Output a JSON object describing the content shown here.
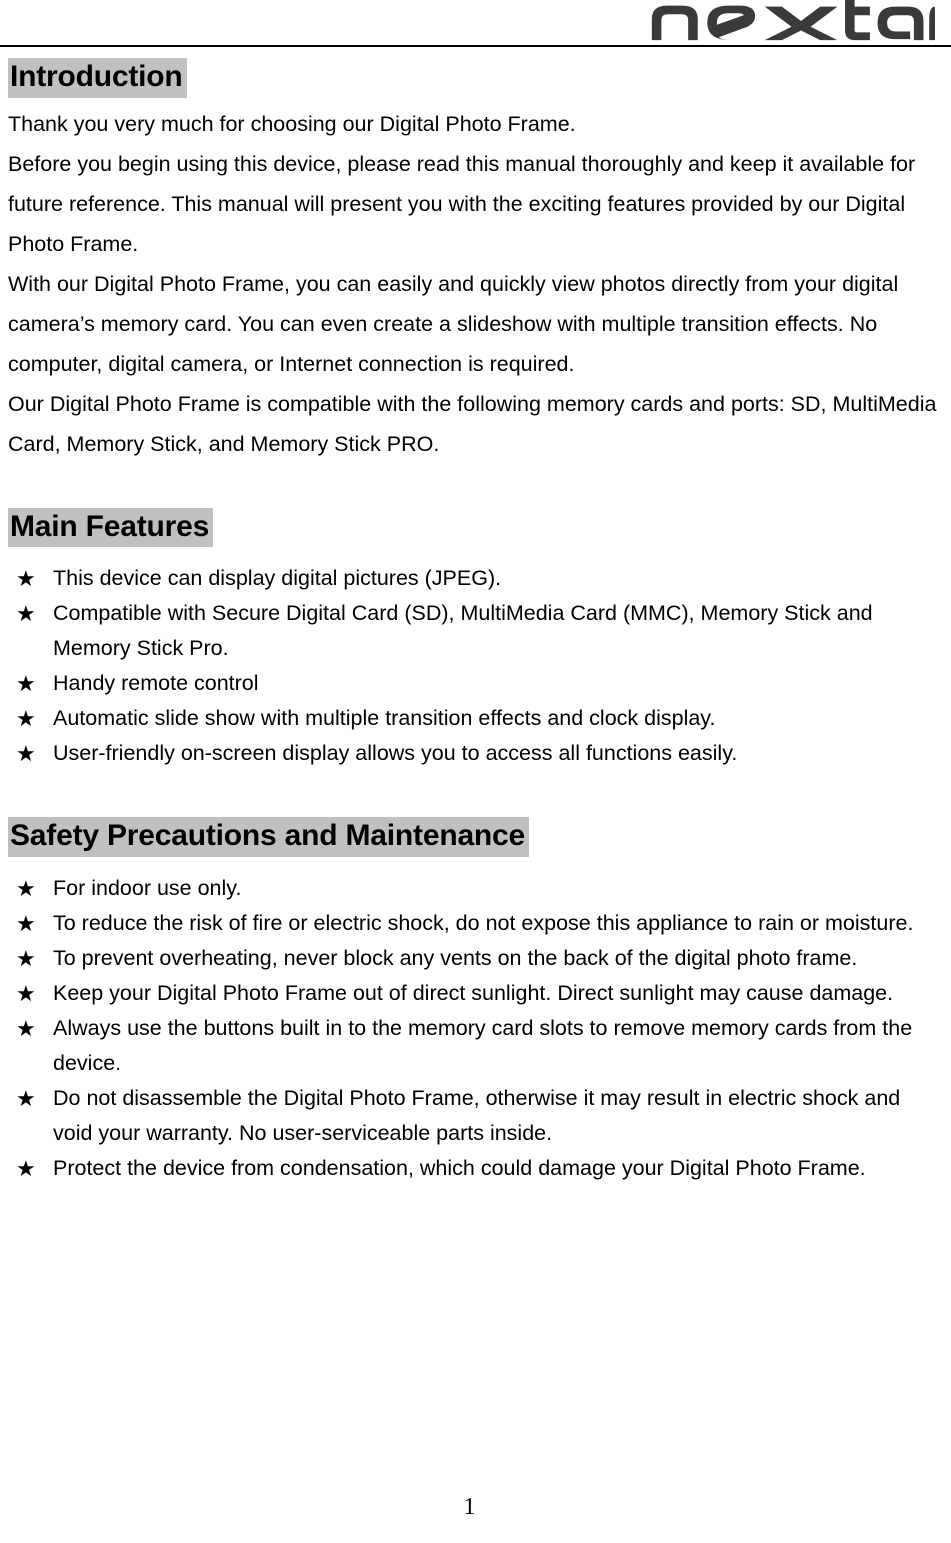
{
  "header": {
    "logo_text": "nextar",
    "logo_name": "nextar-logo"
  },
  "sections": {
    "introduction": {
      "heading": "Introduction",
      "paragraph_lines": [
        "Thank you very much for choosing our Digital Photo Frame.",
        "Before you begin using this device, please read this manual thoroughly and keep it available for future reference. This manual will present you with the exciting features provided by our Digital Photo Frame.",
        "With our Digital Photo Frame, you can easily and quickly view photos directly from your digital camera’s memory card. You can even create a slideshow with multiple transition effects. No computer, digital camera, or Internet connection is required.",
        "Our Digital Photo Frame is compatible with the following memory cards and ports: SD, MultiMedia Card, Memory Stick, and Memory Stick PRO."
      ]
    },
    "main_features": {
      "heading": "Main Features",
      "bullet_icon": "star-icon",
      "bullet_glyph": "★",
      "items": [
        "This device can display digital pictures (JPEG).",
        "Compatible with Secure Digital Card (SD), MultiMedia Card (MMC), Memory Stick and Memory Stick Pro.",
        "Handy remote control",
        "Automatic slide show with multiple transition effects and clock display.",
        "User-friendly on-screen display allows you to access all functions easily."
      ]
    },
    "safety": {
      "heading": "Safety Precautions and Maintenance",
      "bullet_icon": "star-icon",
      "bullet_glyph": "★",
      "items": [
        "For indoor use only.",
        "To reduce the risk of fire or electric shock, do not expose this appliance to rain or moisture.",
        "To prevent overheating, never block any vents on the back of the digital photo frame.",
        "Keep your Digital Photo Frame out of direct sunlight. Direct sunlight may cause damage.",
        "Always use the buttons built in to the memory card slots to remove memory cards from the device.",
        "Do not disassemble the Digital Photo Frame, otherwise it may result in electric shock and void your warranty. No user-serviceable parts inside.",
        "Protect the device from condensation, which could damage your Digital Photo Frame."
      ]
    }
  },
  "footer": {
    "page_number": "1"
  },
  "colors": {
    "heading_highlight": "#c0c0c0",
    "text": "#000000",
    "logo": "#3a3a3a",
    "rule": "#000000",
    "background": "#ffffff"
  }
}
